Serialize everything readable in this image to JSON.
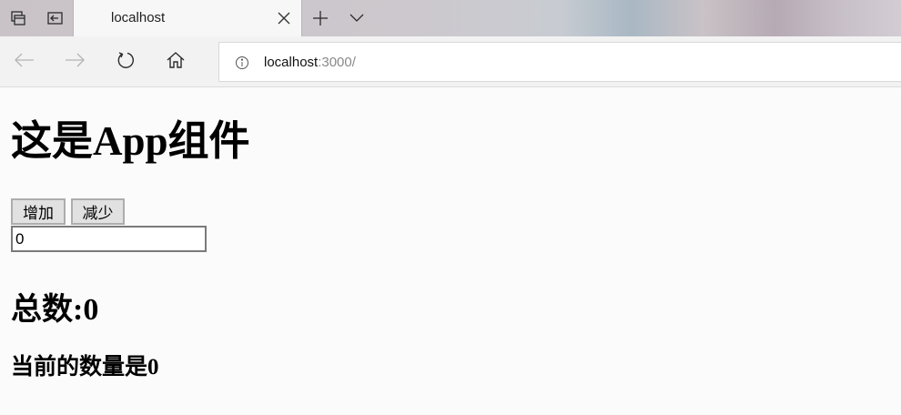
{
  "browser": {
    "tab": {
      "title": "localhost"
    },
    "toolbar_icons": [
      "tab-preview-icon",
      "set-aside-tabs-icon",
      "close-icon",
      "new-tab-icon",
      "tab-menu-chevron-icon"
    ],
    "nav_icons": [
      "back-arrow-icon",
      "forward-arrow-icon",
      "refresh-icon",
      "home-icon",
      "info-icon"
    ],
    "address": {
      "host": "localhost",
      "rest": ":3000/"
    }
  },
  "page": {
    "title": "这是App组件",
    "buttons": {
      "add": "增加",
      "subtract": "减少"
    },
    "input_value": "0",
    "total_text": "总数:0",
    "current_text": "当前的数量是0"
  }
}
